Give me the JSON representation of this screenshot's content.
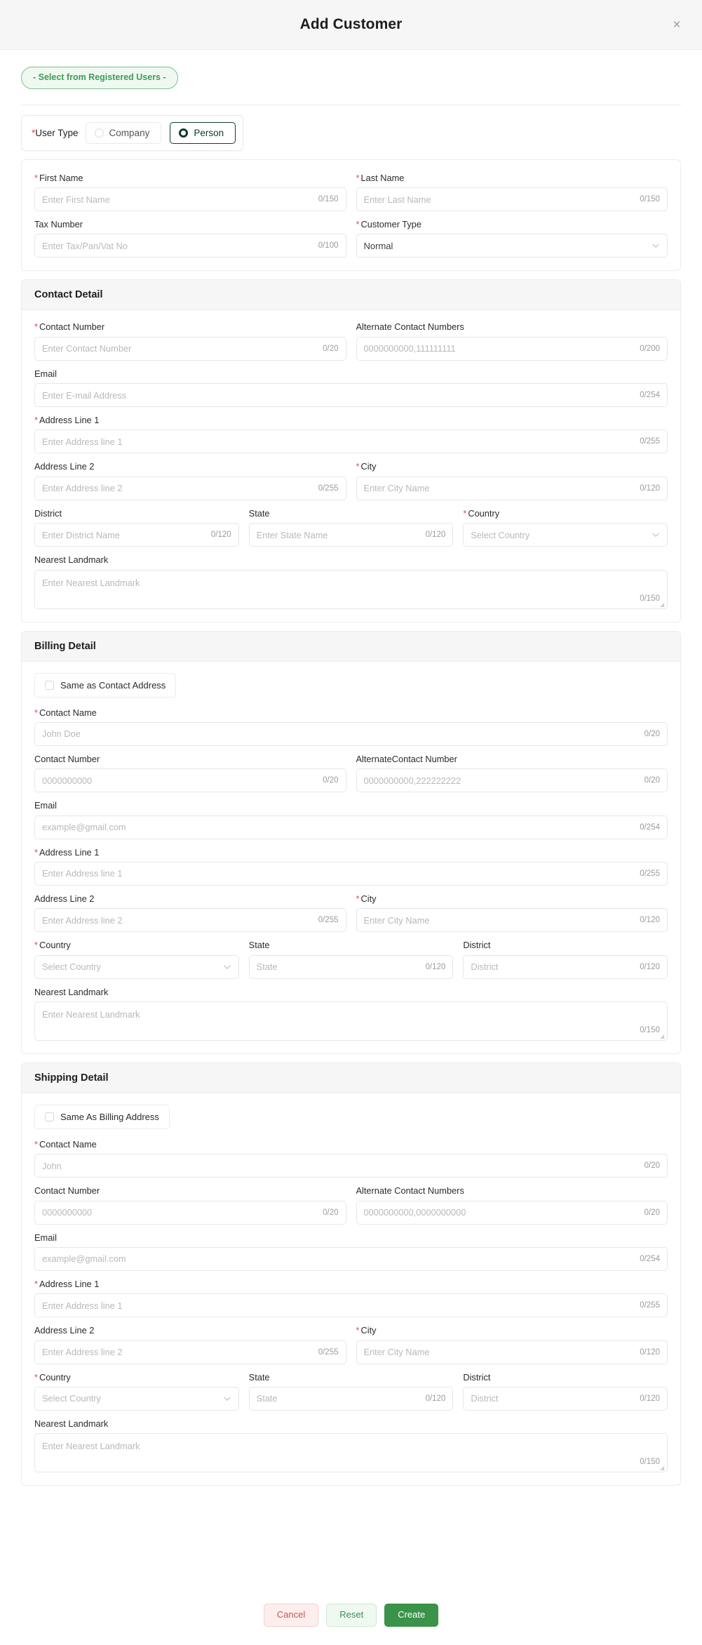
{
  "header": {
    "title": "Add Customer",
    "close_label": "×"
  },
  "select_registered_users": {
    "label": "- Select from Registered Users -"
  },
  "user_type": {
    "label": "User Type",
    "required_mark": "*",
    "options": [
      {
        "label": "Company",
        "selected": false
      },
      {
        "label": "Person",
        "selected": true
      }
    ]
  },
  "basic_info": {
    "first_name": {
      "label": "First Name",
      "required": "*",
      "placeholder": "Enter First Name",
      "counter": "0/150"
    },
    "last_name": {
      "label": "Last Name",
      "required": "*",
      "placeholder": "Enter Last Name",
      "counter": "0/150"
    },
    "tax_number": {
      "label": "Tax Number",
      "required": "",
      "placeholder": "Enter Tax/Pan/Vat No",
      "counter": "0/100"
    },
    "customer_type": {
      "label": "Customer Type",
      "required": "*",
      "value": "Normal",
      "chevron": "chevron-down-icon"
    }
  },
  "contact_detail": {
    "heading": "Contact Detail",
    "contact_number": {
      "label": "Contact Number",
      "required": "*",
      "placeholder": "Enter Contact Number",
      "counter": "0/20"
    },
    "alternate_contact": {
      "label": "Alternate Contact Numbers",
      "required": "",
      "placeholder": "0000000000,111111111",
      "counter": "0/200"
    },
    "email": {
      "label": "Email",
      "required": "",
      "placeholder": "Enter E-mail Address",
      "counter": "0/254"
    },
    "address_line_1": {
      "label": "Address Line 1",
      "required": "*",
      "placeholder": "Enter Address line 1",
      "counter": "0/255"
    },
    "address_line_2": {
      "label": "Address Line 2",
      "required": "",
      "placeholder": "Enter Address line 2",
      "counter": "0/255"
    },
    "city": {
      "label": "City",
      "required": "*",
      "placeholder": "Enter City Name",
      "counter": "0/120"
    },
    "district": {
      "label": "District",
      "required": "",
      "placeholder": "Enter District Name",
      "counter": "0/120"
    },
    "state": {
      "label": "State",
      "required": "",
      "placeholder": "Enter State Name",
      "counter": "0/120"
    },
    "country": {
      "label": "Country",
      "required": "*",
      "placeholder": "Select Country",
      "chevron": "chevron-down-icon"
    },
    "nearest_landmark": {
      "label": "Nearest Landmark",
      "required": "",
      "placeholder": "Enter Nearest Landmark",
      "counter": "0/150"
    }
  },
  "billing_detail": {
    "heading": "Billing Detail",
    "same_as": {
      "label": "Same as Contact Address",
      "checked": false
    },
    "contact_name": {
      "label": "Contact Name",
      "required": "*",
      "placeholder": "John Doe",
      "counter": "0/20"
    },
    "contact_number": {
      "label": "Contact Number",
      "required": "",
      "placeholder": "0000000000",
      "counter": "0/20"
    },
    "alternate_contact": {
      "label": "AlternateContact Number",
      "required": "",
      "placeholder": "0000000000,222222222",
      "counter": "0/20"
    },
    "email": {
      "label": "Email",
      "required": "",
      "placeholder": "example@gmail.com",
      "counter": "0/254"
    },
    "address_line_1": {
      "label": "Address Line 1",
      "required": "*",
      "placeholder": "Enter Address line 1",
      "counter": "0/255"
    },
    "address_line_2": {
      "label": "Address Line 2",
      "required": "",
      "placeholder": "Enter Address line 2",
      "counter": "0/255"
    },
    "city": {
      "label": "City",
      "required": "*",
      "placeholder": "Enter City Name",
      "counter": "0/120"
    },
    "country": {
      "label": "Country",
      "required": "*",
      "placeholder": "Select Country",
      "chevron": "chevron-down-icon"
    },
    "state": {
      "label": "State",
      "required": "",
      "placeholder": "State",
      "counter": "0/120"
    },
    "district": {
      "label": "District",
      "required": "",
      "placeholder": "District",
      "counter": "0/120"
    },
    "nearest_landmark": {
      "label": "Nearest Landmark",
      "required": "",
      "placeholder": "Enter Nearest Landmark",
      "counter": "0/150"
    }
  },
  "shipping_detail": {
    "heading": "Shipping Detail",
    "same_as": {
      "label": "Same As Billing Address",
      "checked": false
    },
    "contact_name": {
      "label": "Contact Name",
      "required": "*",
      "placeholder": "John",
      "counter": "0/20"
    },
    "contact_number": {
      "label": "Contact Number",
      "required": "",
      "placeholder": "0000000000",
      "counter": "0/20"
    },
    "alternate_contact": {
      "label": "Alternate Contact Numbers",
      "required": "",
      "placeholder": "0000000000,0000000000",
      "counter": "0/20"
    },
    "email": {
      "label": "Email",
      "required": "",
      "placeholder": "example@gmail.com",
      "counter": "0/254"
    },
    "address_line_1": {
      "label": "Address Line 1",
      "required": "*",
      "placeholder": "Enter Address line 1",
      "counter": "0/255"
    },
    "address_line_2": {
      "label": "Address Line 2",
      "required": "",
      "placeholder": "Enter Address line 2",
      "counter": "0/255"
    },
    "city": {
      "label": "City",
      "required": "*",
      "placeholder": "Enter City Name",
      "counter": "0/120"
    },
    "country": {
      "label": "Country",
      "required": "*",
      "placeholder": "Select Country",
      "chevron": "chevron-down-icon"
    },
    "state": {
      "label": "State",
      "required": "",
      "placeholder": "State",
      "counter": "0/120"
    },
    "district": {
      "label": "District",
      "required": "",
      "placeholder": "District",
      "counter": "0/120"
    },
    "nearest_landmark": {
      "label": "Nearest Landmark",
      "required": "",
      "placeholder": "Enter Nearest Landmark",
      "counter": "0/150"
    }
  },
  "footer": {
    "cancel_label": "Cancel",
    "reset_label": "Reset",
    "create_label": "Create"
  },
  "colors": {
    "accent_green": "#3a9348",
    "pill_green_text": "#3b9e55",
    "pill_green_bg": "#eff9f1",
    "required_red": "#e5484d",
    "cancel_red": "#c65757",
    "section_bg": "#f6f6f6",
    "radio_selected": "#123c2c"
  }
}
